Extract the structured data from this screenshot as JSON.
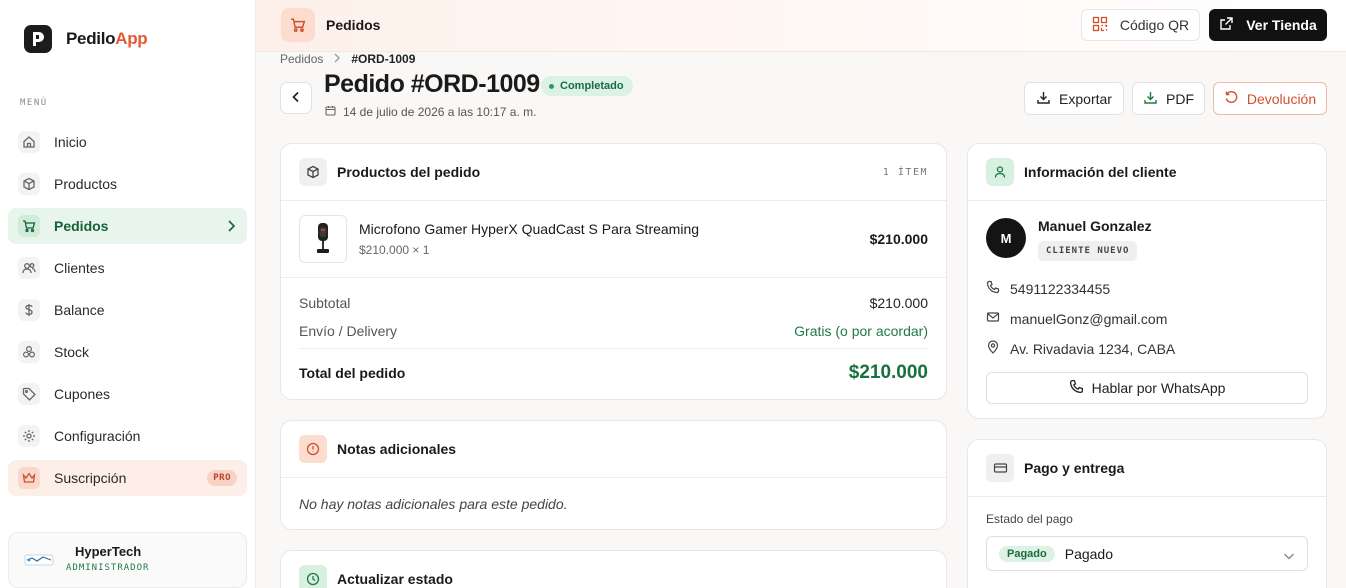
{
  "brand": {
    "name_part1": "Pedilo",
    "name_part2": "App"
  },
  "sidebar": {
    "menu_label": "MENÚ",
    "items": [
      {
        "label": "Inicio",
        "icon": "home-icon"
      },
      {
        "label": "Productos",
        "icon": "box-icon"
      },
      {
        "label": "Pedidos",
        "icon": "cart-icon",
        "active": true
      },
      {
        "label": "Clientes",
        "icon": "users-icon"
      },
      {
        "label": "Balance",
        "icon": "dollar-icon"
      },
      {
        "label": "Stock",
        "icon": "stock-icon"
      },
      {
        "label": "Cupones",
        "icon": "tag-icon"
      },
      {
        "label": "Configuración",
        "icon": "gear-icon"
      }
    ],
    "subscription": {
      "label": "Suscripción",
      "badge": "PRO"
    },
    "account": {
      "name": "HyperTech",
      "role": "ADMINISTRADOR"
    }
  },
  "header": {
    "title": "Pedidos",
    "qr_label": "Código QR",
    "store_label": "Ver Tienda"
  },
  "breadcrumb": {
    "parent": "Pedidos",
    "current": "#ORD-1009"
  },
  "order": {
    "title": "Pedido #ORD-1009",
    "status": "Completado",
    "date": "14 de julio de 2026 a las 10:17 a. m."
  },
  "actions": {
    "export": "Exportar",
    "pdf": "PDF",
    "refund": "Devolución"
  },
  "products_card": {
    "title": "Productos del pedido",
    "count": "1 ÍTEM",
    "items": [
      {
        "name": "Microfono Gamer HyperX QuadCast S Para Streaming",
        "unit": "$210.000 × 1",
        "price": "$210.000"
      }
    ],
    "subtotal_label": "Subtotal",
    "subtotal_value": "$210.000",
    "shipping_label": "Envío / Delivery",
    "shipping_value": "Gratis (o por acordar)",
    "total_label": "Total del pedido",
    "total_value": "$210.000"
  },
  "notes_card": {
    "title": "Notas adicionales",
    "text": "No hay notas adicionales para este pedido."
  },
  "status_card": {
    "title": "Actualizar estado"
  },
  "customer_card": {
    "title": "Información del cliente",
    "initial": "M",
    "name": "Manuel Gonzalez",
    "badge": "CLIENTE NUEVO",
    "phone": "5491122334455",
    "email": "manuelGonz@gmail.com",
    "address": "Av. Rivadavia 1234, CABA",
    "whatsapp_label": "Hablar por WhatsApp"
  },
  "payment_card": {
    "title": "Pago y entrega",
    "status_label": "Estado del pago",
    "status_pill": "Pagado",
    "status_value": "Pagado"
  },
  "colors": {
    "accent": "#e25a33",
    "success": "#17703f",
    "dark": "#111111"
  }
}
